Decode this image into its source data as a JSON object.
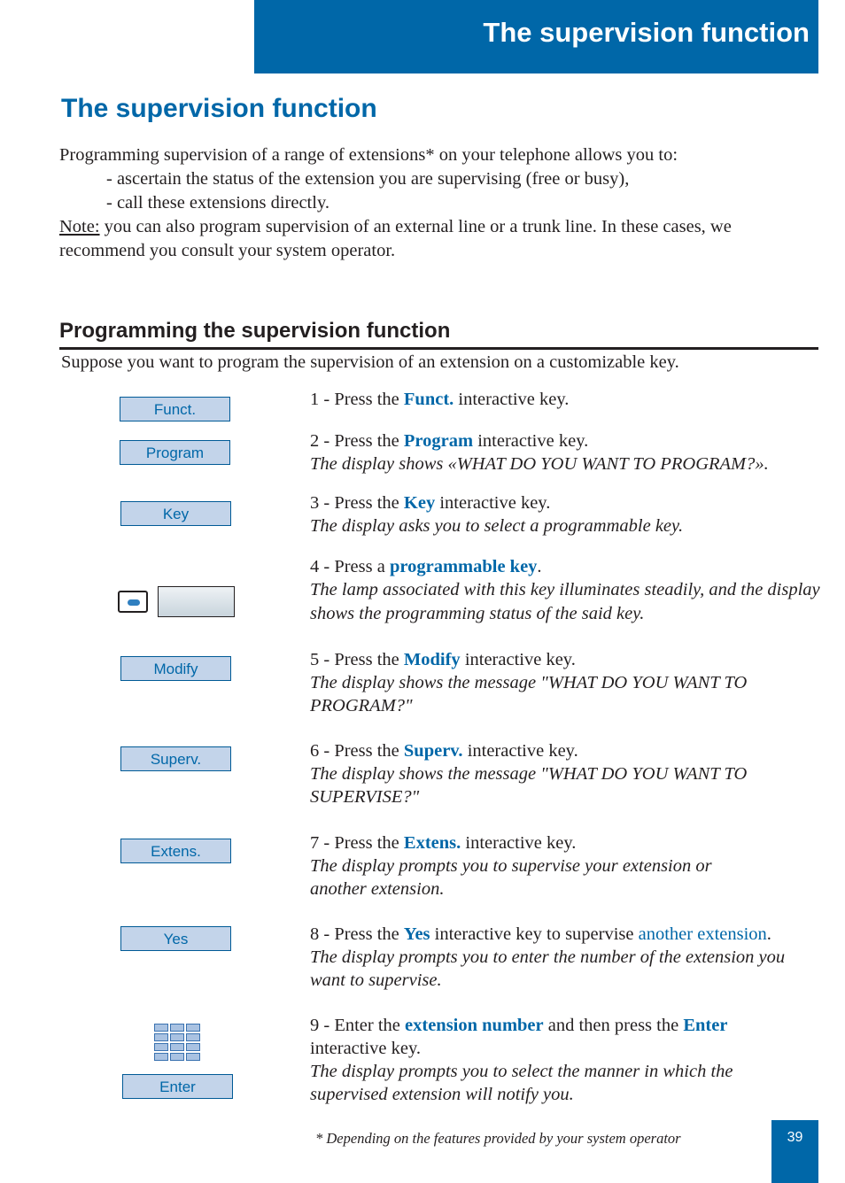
{
  "header": {
    "title": "The supervision function"
  },
  "page_title": "The supervision function",
  "intro": {
    "line1": "Programming supervision of a range of extensions* on your telephone allows you to:",
    "bullet1": "- ascertain the status of the extension you are supervising (free or busy),",
    "bullet2": "- call these extensions directly.",
    "note_label": "Note:",
    "note_text": " you can also program supervision of an external line or a trunk line. In these cases, we recommend you consult your system operator."
  },
  "section": {
    "title": "Programming the supervision function",
    "lead": "Suppose you want to program the supervision of an extension on a customizable key."
  },
  "keys": {
    "funct": "Funct.",
    "program": "Program",
    "key": "Key",
    "modify": "Modify",
    "superv": "Superv.",
    "extens": "Extens.",
    "yes": "Yes",
    "enter": "Enter"
  },
  "steps": [
    {
      "pre": "1 - Press the ",
      "key": "Funct.",
      "post": " interactive key."
    },
    {
      "pre": "2 - Press the ",
      "key": "Program",
      "post": " interactive key.",
      "desc": "The display shows «WHAT DO YOU WANT TO PROGRAM?»."
    },
    {
      "pre": "3 - Press the ",
      "key": "Key",
      "post": " interactive key.",
      "desc": "The display asks you to select a programmable key."
    },
    {
      "pre": "4 - Press a ",
      "key": "programmable key",
      "post": ".",
      "desc": "The lamp associated with this key illuminates steadily, and the display shows the programming status of the said key."
    },
    {
      "pre": "5 - Press the ",
      "key": "Modify",
      "post": " interactive key.",
      "desc": "The display shows the message \"WHAT DO YOU WANT TO PROGRAM?\""
    },
    {
      "pre": "6 - Press the ",
      "key": "Superv.",
      "post": " interactive key.",
      "desc": "The display shows the message \"WHAT DO YOU WANT TO SUPERVISE?\""
    },
    {
      "pre": "7 - Press the ",
      "key": "Extens.",
      "post": " interactive key.",
      "desc": "The display prompts you to supervise your extension or another extension."
    },
    {
      "pre": "8 - Press the ",
      "key": "Yes",
      "mid": " interactive key to supervise ",
      "link": "another extension",
      "post": ".",
      "desc": "The display prompts you to enter the number of the extension you want to supervise."
    },
    {
      "pre": "9 - Enter the ",
      "key": "extension number",
      "mid": " and then press the ",
      "key2": "Enter",
      "post": " interactive key.",
      "desc": "The display prompts you to select the manner in which the supervised extension will notify you."
    }
  ],
  "footnote": "* Depending on the features provided by your system operator",
  "page_number": "39"
}
